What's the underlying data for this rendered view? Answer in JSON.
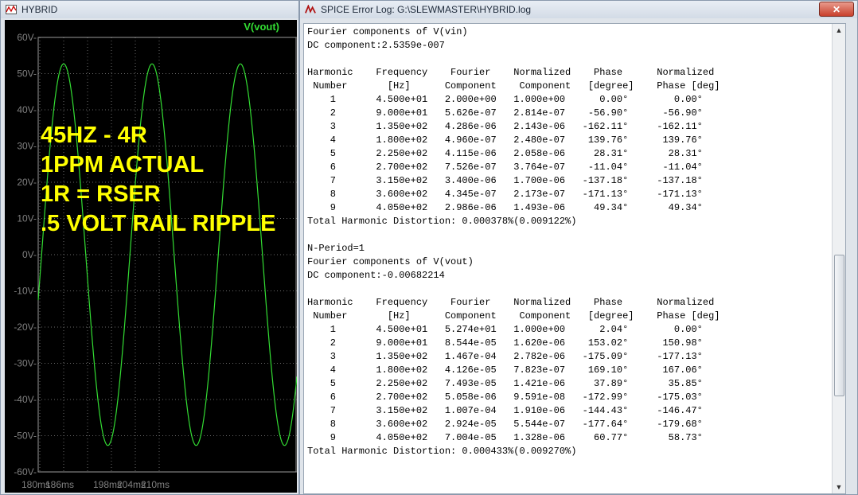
{
  "left_window": {
    "title": "HYBRID",
    "trace_label": "V(vout)",
    "annotation_lines": [
      "45HZ - 4R",
      "1PPM ACTUAL",
      "1R = RSER",
      ".5 VOLT RAIL RIPPLE"
    ],
    "y_ticks": [
      "60V-",
      "50V-",
      "40V-",
      "30V-",
      "20V-",
      "10V-",
      "0V-",
      "-10V-",
      "-20V-",
      "-30V-",
      "-40V-",
      "-50V-",
      "-60V-"
    ],
    "x_ticks": [
      "180ms",
      "186ms",
      "198ms",
      "204ms",
      "210ms"
    ],
    "colors": {
      "trace": "#33dd33",
      "label": "#33dd33",
      "annotation": "#ffff00",
      "grid": "#6a6a6a",
      "background": "#000000"
    }
  },
  "right_window": {
    "title": "SPICE Error Log: G:\\SLEWMASTER\\HYBRID.log",
    "close_label": "✕",
    "log_lines": [
      "Fourier components of V(vin)",
      "DC component:2.5359e-007",
      "",
      "Harmonic    Frequency    Fourier    Normalized    Phase      Normalized",
      " Number       [Hz]      Component    Component   [degree]    Phase [deg]",
      "    1       4.500e+01   2.000e+00   1.000e+00      0.00°        0.00°",
      "    2       9.000e+01   5.626e-07   2.814e-07    -56.90°      -56.90°",
      "    3       1.350e+02   4.286e-06   2.143e-06   -162.11°     -162.11°",
      "    4       1.800e+02   4.960e-07   2.480e-07    139.76°      139.76°",
      "    5       2.250e+02   4.115e-06   2.058e-06     28.31°       28.31°",
      "    6       2.700e+02   7.526e-07   3.764e-07    -11.04°      -11.04°",
      "    7       3.150e+02   3.400e-06   1.700e-06   -137.18°     -137.18°",
      "    8       3.600e+02   4.345e-07   2.173e-07   -171.13°     -171.13°",
      "    9       4.050e+02   2.986e-06   1.493e-06     49.34°       49.34°",
      "Total Harmonic Distortion: 0.000378%(0.009122%)",
      "",
      "N-Period=1",
      "Fourier components of V(vout)",
      "DC component:-0.00682214",
      "",
      "Harmonic    Frequency    Fourier    Normalized    Phase      Normalized",
      " Number       [Hz]      Component    Component   [degree]    Phase [deg]",
      "    1       4.500e+01   5.274e+01   1.000e+00      2.04°        0.00°",
      "    2       9.000e+01   8.544e-05   1.620e-06    153.02°      150.98°",
      "    3       1.350e+02   1.467e-04   2.782e-06   -175.09°     -177.13°",
      "    4       1.800e+02   4.126e-05   7.823e-07    169.10°      167.06°",
      "    5       2.250e+02   7.493e-05   1.421e-06     37.89°       35.85°",
      "    6       2.700e+02   5.058e-06   9.591e-08   -172.99°     -175.03°",
      "    7       3.150e+02   1.007e-04   1.910e-06   -144.43°     -146.47°",
      "    8       3.600e+02   2.924e-05   5.544e-07   -177.64°     -179.68°",
      "    9       4.050e+02   7.004e-05   1.328e-06     60.77°       58.73°",
      "Total Harmonic Distortion: 0.000433%(0.009270%)"
    ]
  }
}
